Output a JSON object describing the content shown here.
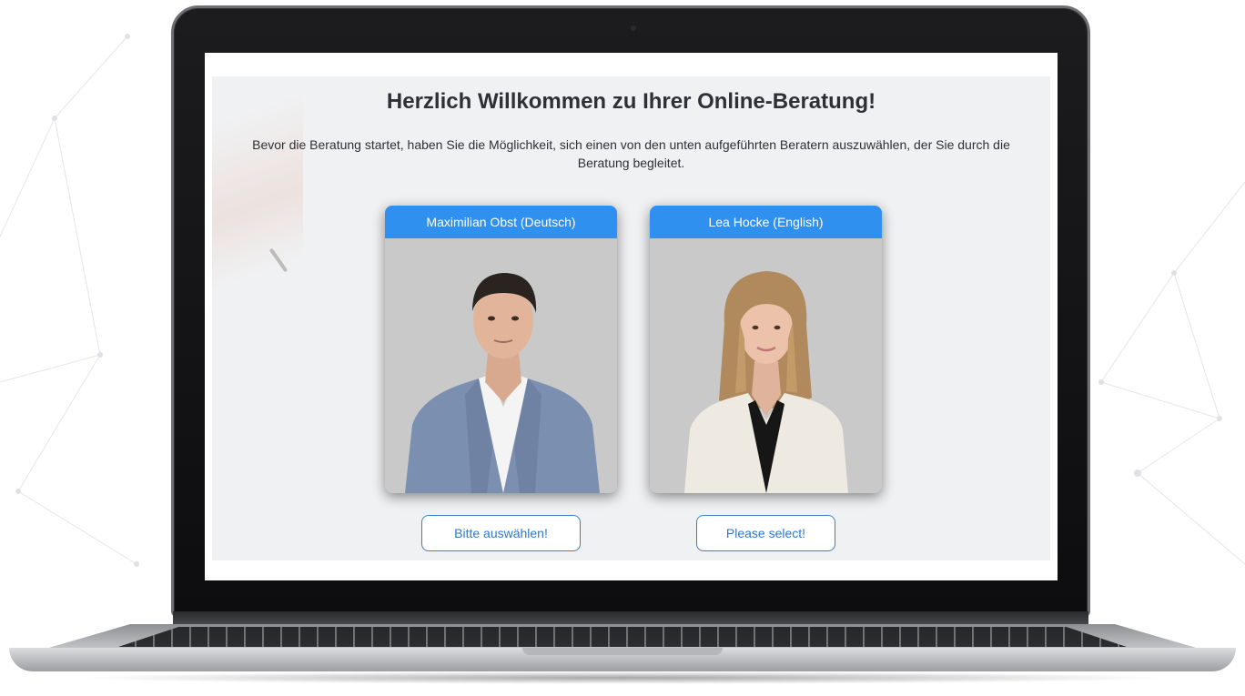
{
  "page": {
    "title": "Herzlich Willkommen zu Ihrer Online-Beratung!",
    "subtitle": "Bevor die Beratung startet, haben Sie die Möglichkeit, sich einen von den unten aufgeführten Beratern auszuwählen, der Sie durch die Beratung begleitet."
  },
  "advisors": [
    {
      "name": "Maximilian Obst (Deutsch)",
      "button_label": "Bitte auswählen!"
    },
    {
      "name": "Lea Hocke (English)",
      "button_label": "Please select!"
    }
  ],
  "colors": {
    "accent": "#3090f0",
    "button_text": "#2f78c8",
    "button_border": "#3d7fc4",
    "panel_bg": "#f0f1f3",
    "photo_bg": "#c9c9c9"
  },
  "icons": {
    "advisor_photo_1": "man-portrait",
    "advisor_photo_2": "woman-portrait"
  }
}
